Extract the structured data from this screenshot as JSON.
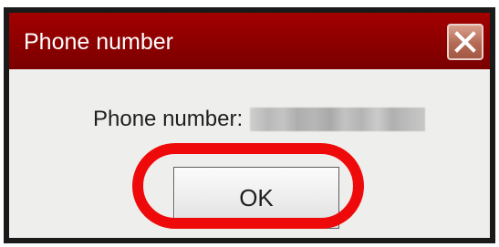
{
  "window": {
    "title": "Phone number",
    "close_icon": "close-x-icon",
    "titlebar_color": "#8e0000"
  },
  "dialog": {
    "prompt_label": "Phone number:",
    "value_redacted": true,
    "ok_label": "OK"
  },
  "annotation": {
    "highlight_color": "#ee0a0a",
    "highlight_target": "OK button"
  }
}
